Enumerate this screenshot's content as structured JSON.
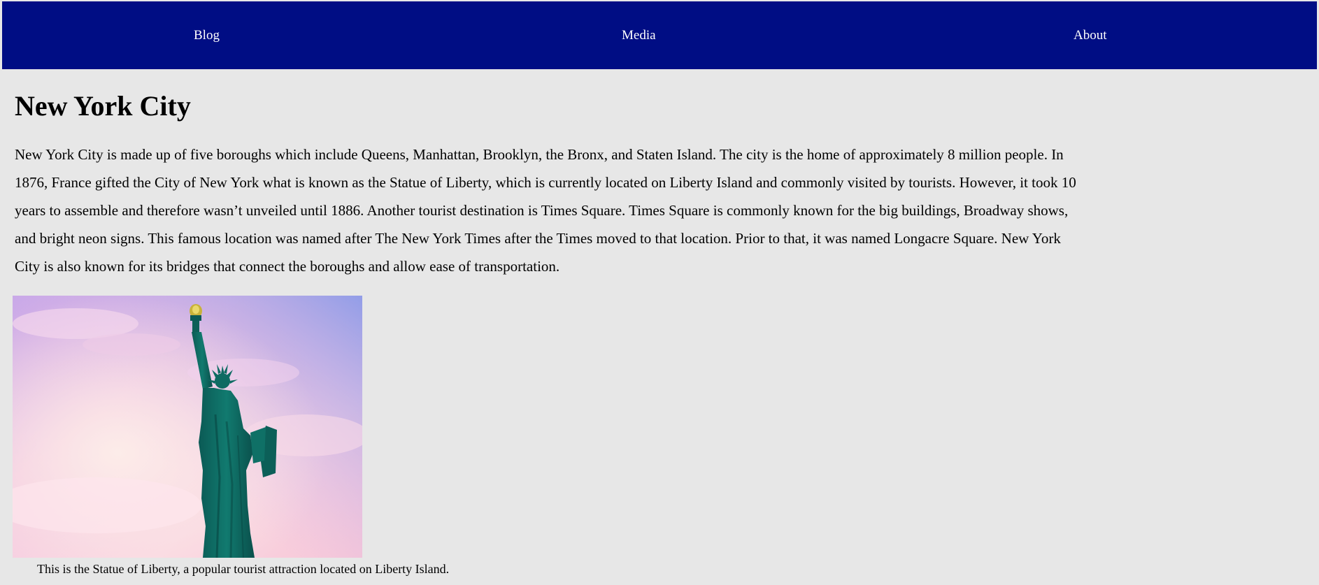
{
  "nav": {
    "items": [
      {
        "label": "Blog"
      },
      {
        "label": "Media"
      },
      {
        "label": "About"
      }
    ]
  },
  "main": {
    "title": "New York City",
    "intro": "New York City is made up of five boroughs which include Queens, Manhattan, Brooklyn, the Bronx, and Staten Island. The city is the home of approximately 8 million people. In 1876, France gifted the City of New York what is known as the Statue of Liberty, which is currently located on Liberty Island and commonly visited by tourists. However, it took 10 years to assemble and therefore wasn’t unveiled until 1886. Another tourist destination is Times Square. Times Square is commonly known for the big buildings, Broadway shows, and bright neon signs. This famous location was named after The New York Times after the Times moved to that location. Prior to that, it was named Longacre Square. New York City is also known for its bridges that connect the boroughs and allow ease of transportation.",
    "figure": {
      "caption": "This is the Statue of Liberty, a popular tourist attraction located on Liberty Island."
    }
  },
  "colors": {
    "nav_background": "#000d84",
    "page_background": "#e7e7e7",
    "statue": "#0e6b62"
  }
}
